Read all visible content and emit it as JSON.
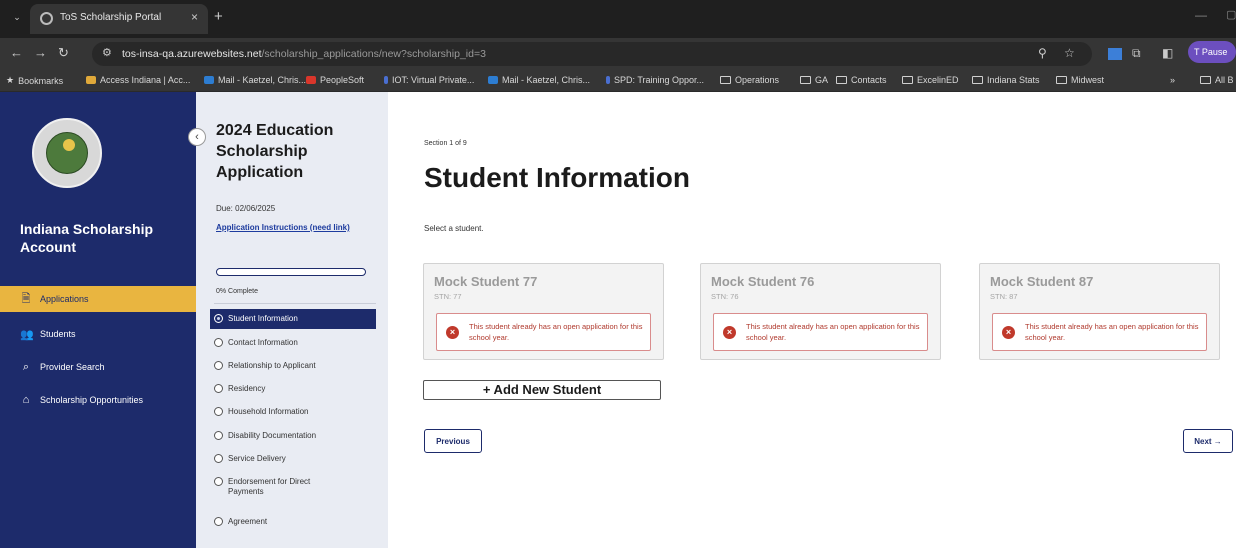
{
  "browser": {
    "tab_title": "ToS Scholarship Portal",
    "tab_close": "×",
    "new_tab": "+",
    "url_host": "tos-insa-qa.azurewebsites.net",
    "url_path": "/scholarship_applications/new?scholarship_id=3",
    "profile_label": "T  Pause",
    "bookmarks": [
      "Bookmarks",
      "Access Indiana | Acc...",
      "Mail - Kaetzel, Chris...",
      "PeopleSoft",
      "IOT: Virtual Private...",
      "Mail - Kaetzel, Chris...",
      "SPD: Training Oppor...",
      "Operations",
      "GA",
      "Contacts",
      "ExcelinED",
      "Indiana Stats",
      "Midwest",
      "»",
      "All B"
    ]
  },
  "sidebar": {
    "account_title": "Indiana Scholarship Account",
    "collapse_glyph": "‹",
    "items": [
      {
        "label": "Applications",
        "icon": "document-icon",
        "glyph": "🗎"
      },
      {
        "label": "Students",
        "icon": "users-icon",
        "glyph": "👥"
      },
      {
        "label": "Provider Search",
        "icon": "search-icon",
        "glyph": "⌕"
      },
      {
        "label": "Scholarship Opportunities",
        "icon": "scholarship-icon",
        "glyph": "⌂"
      }
    ]
  },
  "application": {
    "title": "2024 Education Scholarship Application",
    "due": "Due: 02/06/2025",
    "instructions_link": "Application Instructions (need link)",
    "progress_percent": 0,
    "progress_text": "0% Complete",
    "sections": [
      "Student Information",
      "Contact Information",
      "Relationship to Applicant",
      "Residency",
      "Household Information",
      "Disability Documentation",
      "Service Delivery",
      "Endorsement for Direct Payments",
      "Agreement"
    ]
  },
  "main": {
    "section_count": "Section 1 of 9",
    "page_title": "Student Information",
    "prompt": "Select a student.",
    "students": [
      {
        "name": "Mock Student 77",
        "stn": "STN: 77",
        "alert": "This student already has an open application for this school year."
      },
      {
        "name": "Mock Student 76",
        "stn": "STN: 76",
        "alert": "This student already has an open application for this school year."
      },
      {
        "name": "Mock Student 87",
        "stn": "STN: 87",
        "alert": "This student already has an open application for this school year."
      }
    ],
    "add_student": "+ Add New Student",
    "previous": "Previous",
    "next": "Next →"
  },
  "colors": {
    "navy": "#1d2b6b",
    "gold_active": "#e9b540",
    "alert_red": "#c0392b"
  }
}
